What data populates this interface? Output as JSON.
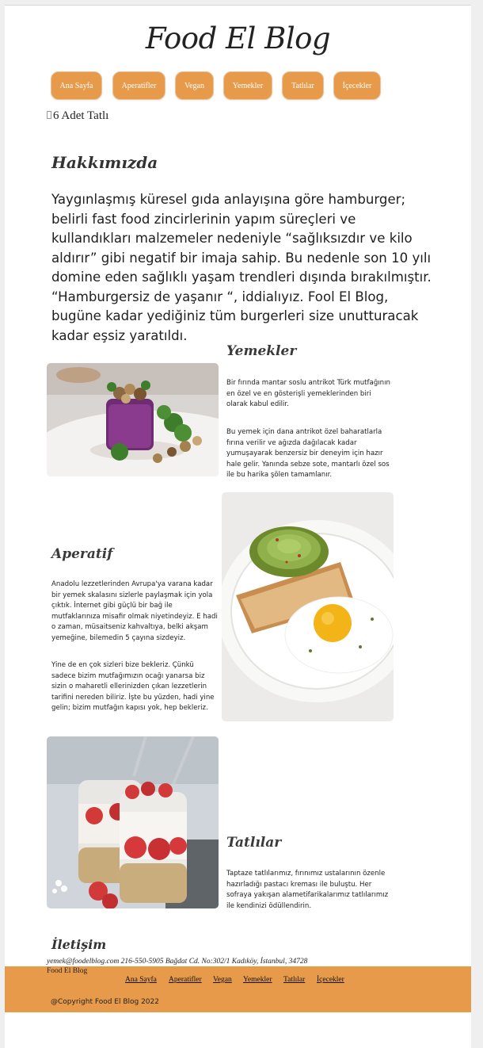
{
  "site": {
    "title": "Food El Blog"
  },
  "nav": {
    "items": [
      {
        "label": "Ana Sayfa"
      },
      {
        "label": "Aperatifler"
      },
      {
        "label": "Vegan"
      },
      {
        "label": "Yemekler"
      },
      {
        "label": "Tatlılar"
      },
      {
        "label": "İçecekler"
      }
    ]
  },
  "hero": {
    "image_alt": "6 Adet Tatlı"
  },
  "about": {
    "title": "Hakkımızda",
    "text": "Yaygınlaşmış küresel gıda anlayışına göre hamburger; belirli fast food zincirlerinin yapım süreçleri ve kullandıkları malzemeler nedeniyle “sağlıksızdır ve kilo aldırır” gibi negatif bir imaja sahip. Bu nedenle son 10 yılı domine eden sağlıklı yaşam trendleri dışında bırakılmıştır. “Hamburgersiz de yaşanır “, iddialıyız. Fool El Blog, bugüne kadar yediğiniz tüm burgerleri size unutturacak kadar eşsiz yaratıldı."
  },
  "sections": {
    "yemekler": {
      "title": "Yemekler",
      "p1": "Bir fırında mantar soslu antrikot Türk mutfağının en özel ve en gösterişli yemeklerinden biri olarak kabul edilir.",
      "p2": "Bu yemek için dana antrikot özel baharatlarla fırına verilir ve ağızda dağılacak kadar yumuşayarak benzersiz bir deneyim için hazır hale gelir. Yanında sebze sote, mantarlı özel sos ile bu harika şölen tamamlanır."
    },
    "aperatif": {
      "title": "Aperatif",
      "p1": "Anadolu lezzetlerinden Avrupa'ya varana kadar bir yemek skalasını sizlerle paylaşmak için yola çıktık. İnternet gibi güçlü bir bağ ile mutfaklarınıza misafir olmak niyetindeyiz. E hadi o zaman, müsaitseniz kahvaltıya, belki akşam yemeğine, bilemedin 5 çayına sizdeyiz.",
      "p2": "Yine de en çok sizleri bize bekleriz. Çünkü sadece bizim mutfağımızın ocağı yanarsa biz sizin o maharetli ellerinizden çıkan lezzetlerin tarifini nereden biliriz. İşte bu yüzden, hadi yine gelin; bizim mutfağın kapısı yok, hep bekleriz."
    },
    "tatlilar": {
      "title": "Tatlılar",
      "p1": "Taptaze tatlılarımız, fırınımız ustalarının özenle hazırladığı pastacı kreması ile buluştu. Her sofraya yakışan alametifarikalarımız tatlılarımız ile kendinizi ödüllendirin."
    }
  },
  "contact": {
    "title": "İletişim",
    "info": "yemek@foodelblog.com 216-550-5905 Bağdat Cd. No:302/1 Kadıköy, İstanbul, 34728"
  },
  "footer": {
    "brand": "Food El Blog",
    "links": [
      {
        "label": "Ana Sayfa"
      },
      {
        "label": "Aperatifler"
      },
      {
        "label": "Vegan"
      },
      {
        "label": "Yemekler"
      },
      {
        "label": "Tatlılar"
      },
      {
        "label": "İçecekler"
      }
    ],
    "copyright": "@Copyright Food El Blog 2022"
  },
  "colors": {
    "accent": "#e79a49",
    "page_bg": "#ffffff",
    "outer_bg": "#efefef"
  },
  "icons": {
    "broken_image": "broken-image-icon"
  }
}
